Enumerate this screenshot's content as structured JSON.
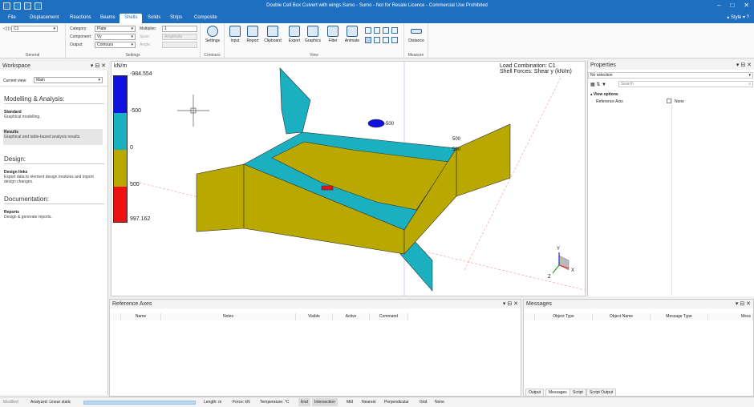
{
  "title_bar": {
    "title": "Double Cell Box Culvert with wings.Sumo - Sumo - Not for Resale Licence - Commercial Use Prohibited"
  },
  "menu": {
    "tabs": [
      "File",
      "Displacement",
      "Reactions",
      "Beams",
      "Shells",
      "Solids",
      "Strips",
      "Composite"
    ],
    "active": "Shells",
    "style_label": "Style"
  },
  "ribbon": {
    "general": {
      "combo_value": "C1",
      "group_label": "General"
    },
    "settings": {
      "category_label": "Category:",
      "category_value": "Plate",
      "component_label": "Component:",
      "component_value": "Vy",
      "output_label": "Output:",
      "output_value": "Contours",
      "multiplier_label": "Multiplier:",
      "multiplier_value": "1",
      "span_label": "Span:",
      "span_value": "Amplitude",
      "angle_label": "Angle:",
      "angle_value": "",
      "group_label": "Settings"
    },
    "contours": {
      "settings_label": "Settings",
      "group_label": "Contours"
    },
    "view": {
      "buttons": [
        "Input",
        "Report",
        "Clipboard",
        "Export",
        "Graphics",
        "Filter",
        "Animate"
      ],
      "group_label": "View"
    },
    "measure": {
      "distance_label": "Distance",
      "group_label": "Measure"
    }
  },
  "workspace": {
    "header": "Workspace",
    "current_view_label": "Current view:",
    "current_view_value": "Main",
    "sections": [
      {
        "heading": "Modelling & Analysis:",
        "items": [
          {
            "title": "Standard",
            "desc": "Graphical modelling."
          },
          {
            "title": "Results",
            "desc": "Graphical and table-based analysis results."
          }
        ]
      },
      {
        "heading": "Design:",
        "items": [
          {
            "title": "Design links",
            "desc": "Export data to element design modules and import design changes."
          }
        ]
      },
      {
        "heading": "Documentation:",
        "items": [
          {
            "title": "Reports",
            "desc": "Design & generate reports."
          }
        ]
      }
    ]
  },
  "viewport": {
    "unit": "kN/m",
    "load_combination": "Load Combination: C1",
    "shell_forces": "Shell Forces: Shear y (kN/m)",
    "legend": [
      {
        "label": "-984.554",
        "color": "#1010e0"
      },
      {
        "label": "-500",
        "color": "#1ab0c0"
      },
      {
        "label": "0",
        "color": "#b8a800"
      },
      {
        "label": "500",
        "color": "#ee1111"
      },
      {
        "label": "997.162",
        "color": "#ee1111"
      }
    ],
    "model_labels": [
      "-500",
      "500",
      "500"
    ],
    "axis_labels": {
      "y": "Y",
      "z": "Z",
      "x": "X"
    }
  },
  "properties": {
    "header": "Properties",
    "selection": "No selection",
    "search_placeholder": "Search",
    "view_options": "View options",
    "row_name": "Reference Axis",
    "row_value": "None"
  },
  "reference_axes": {
    "header": "Reference Axes",
    "columns": [
      "Name",
      "Notes",
      "Visible",
      "Active",
      "Command"
    ]
  },
  "messages": {
    "header": "Messages",
    "columns": [
      "Object Type",
      "Object Name",
      "Message Type",
      "Mess"
    ],
    "tabs": [
      "Output",
      "Messages",
      "Script",
      "Script Output"
    ],
    "active_tab": "Messages"
  },
  "status": {
    "modified": "Modified",
    "analyzed": "Analyzed: Linear static",
    "length": "Length: m",
    "force": "Force: kN",
    "temperature": "Temperature: °C",
    "snaps": [
      "End",
      "Intersection",
      "Mid",
      "Nearest",
      "Perpendicular",
      "Grid",
      "None"
    ]
  }
}
